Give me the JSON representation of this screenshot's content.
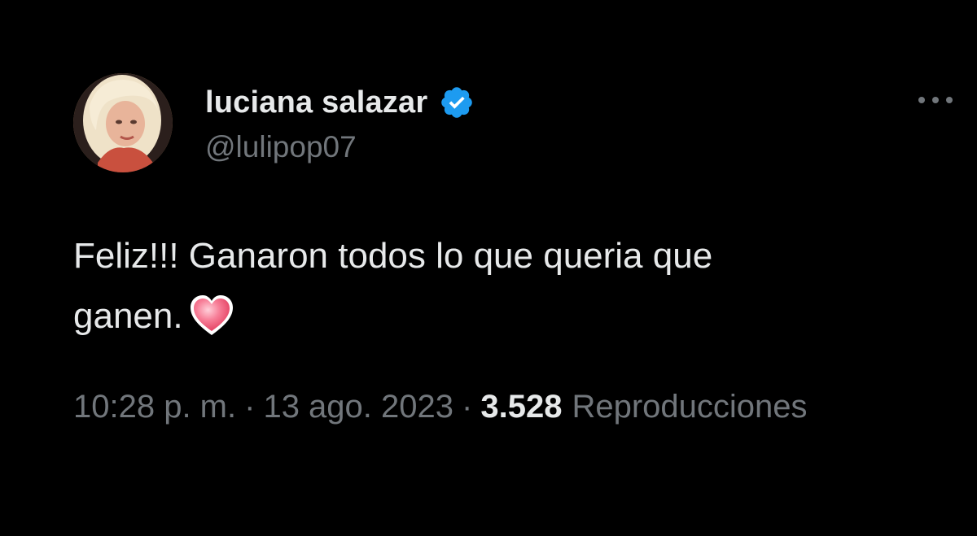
{
  "author": {
    "display_name": "luciana salazar",
    "handle": "@lulipop07",
    "verified": true,
    "verified_icon": "verified-badge-icon",
    "verified_color": "#1d9bf0"
  },
  "tweet": {
    "text_line_1": "Feliz!!! Ganaron todos lo que queria que",
    "text_line_2": "ganen.",
    "emoji": "heart-icon",
    "emoji_color": "#f0506e"
  },
  "meta": {
    "time": "10:28 p. m.",
    "separator_1": "·",
    "date": "13 ago. 2023",
    "separator_2": "·",
    "views_count": "3.528",
    "views_label": "Reproducciones"
  },
  "colors": {
    "background": "#000000",
    "primary_text": "#e7e9ea",
    "secondary_text": "#71767b"
  },
  "more_icon": "more-options-icon"
}
